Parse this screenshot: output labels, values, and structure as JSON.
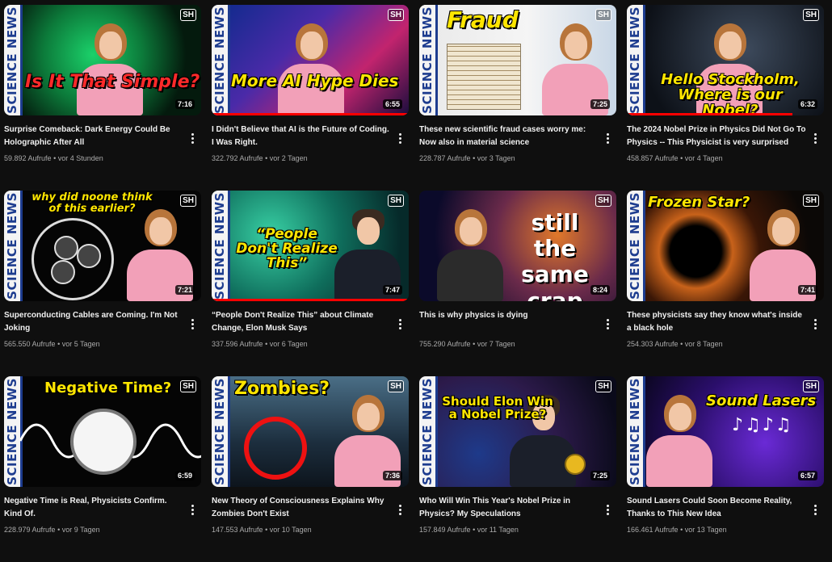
{
  "channel": {
    "strip_label": "SCIENCE NEWS",
    "logo": "SH"
  },
  "colors": {
    "accent": "#ffe600",
    "progress": "#ff0000",
    "background": "#0f0f0f"
  },
  "videos": [
    {
      "title": "Surprise Comeback: Dark Energy Could Be Holographic After All",
      "views": "59.892 Aufrufe",
      "age": "vor 4 Stunden",
      "duration": "7:16",
      "thumb_text": "Is It That Simple?",
      "progress": 0
    },
    {
      "title": "I Didn't Believe that AI is the Future of Coding. I Was Right.",
      "views": "322.792 Aufrufe",
      "age": "vor 2 Tagen",
      "duration": "6:55",
      "thumb_text": "More AI Hype Dies",
      "progress": 1.0
    },
    {
      "title": "These new scientific fraud cases worry me: Now also in material science",
      "views": "228.787 Aufrufe",
      "age": "vor 3 Tagen",
      "duration": "7:25",
      "thumb_text": "Fraud",
      "progress": 0
    },
    {
      "title": "The 2024 Nobel Prize in Physics Did Not Go To Physics -- This Physicist is very surprised",
      "views": "458.857 Aufrufe",
      "age": "vor 4 Tagen",
      "duration": "6:32",
      "thumb_text": "Hello Stockholm, Where is our Nobel?",
      "progress": 0.84
    },
    {
      "title": "Superconducting Cables are Coming. I'm Not Joking",
      "views": "565.550 Aufrufe",
      "age": "vor 5 Tagen",
      "duration": "7:21",
      "thumb_text": "why did noone think of this earlier?",
      "progress": 0
    },
    {
      "title": "“People Don't Realize This” about Climate Change, Elon Musk Says",
      "views": "337.596 Aufrufe",
      "age": "vor 6 Tagen",
      "duration": "7:47",
      "thumb_text": "“People Don't Realize This”",
      "progress": 1.0
    },
    {
      "title": "This is why physics is dying",
      "views": "755.290 Aufrufe",
      "age": "vor 7 Tagen",
      "duration": "8:24",
      "thumb_text": "still the same crap",
      "progress": 0
    },
    {
      "title": "These physicists say they know what's inside a black hole",
      "views": "254.303 Aufrufe",
      "age": "vor 8 Tagen",
      "duration": "7:41",
      "thumb_text": "Frozen Star?",
      "progress": 0
    },
    {
      "title": "Negative Time is Real, Physicists Confirm. Kind Of.",
      "views": "228.979 Aufrufe",
      "age": "vor 9 Tagen",
      "duration": "6:59",
      "thumb_text": "Negative Time?",
      "progress": 0
    },
    {
      "title": "New Theory of Consciousness Explains Why Zombies Don't Exist",
      "views": "147.553 Aufrufe",
      "age": "vor 10 Tagen",
      "duration": "7:36",
      "thumb_text": "Zombies?",
      "progress": 0
    },
    {
      "title": "Who Will Win This Year's Nobel Prize in Physics? My Speculations",
      "views": "157.849 Aufrufe",
      "age": "vor 11 Tagen",
      "duration": "7:25",
      "thumb_text": "Should Elon Win a Nobel Prize?",
      "progress": 0
    },
    {
      "title": "Sound Lasers Could Soon Become Reality, Thanks to This New Idea",
      "views": "166.461 Aufrufe",
      "age": "vor 13 Tagen",
      "duration": "6:57",
      "thumb_text": "Sound Lasers",
      "progress": 0
    }
  ]
}
